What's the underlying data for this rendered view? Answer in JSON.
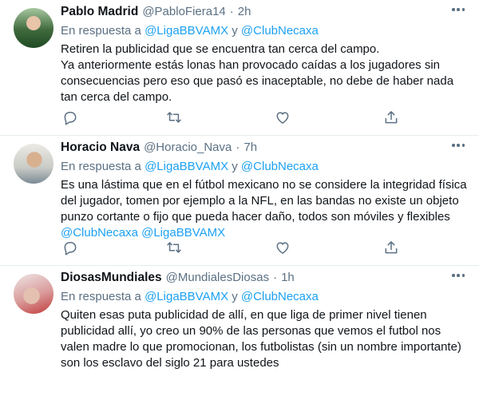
{
  "colors": {
    "link": "#1da1f2",
    "secondary": "#5b7083",
    "text": "#0f1419",
    "divider": "#e6ecf0"
  },
  "reply_prefix": "En respuesta a",
  "reply_joiner": "y",
  "tweets": [
    {
      "name": "Pablo Madrid",
      "handle": "@PabloFiera14",
      "separator": "·",
      "time": "2h",
      "mention_1": "@LigaBBVAMX",
      "mention_2": "@ClubNecaxa",
      "body": "Retiren la publicidad que se encuentra tan cerca del campo.\nYa anteriormente estás lonas han provocado caídas a los jugadores sin consecuencias pero eso que pasó es inaceptable, no debe de haber nada tan cerca del campo.",
      "body_mentions": ""
    },
    {
      "name": "Horacio Nava",
      "handle": "@Horacio_Nava",
      "separator": "·",
      "time": "7h",
      "mention_1": "@LigaBBVAMX",
      "mention_2": "@ClubNecaxa",
      "body": "Es una lástima que en el fútbol mexicano no se considere la integridad física del jugador, tomen por ejemplo a la NFL, en las bandas no existe un objeto punzo cortante o fijo que pueda hacer daño, todos son móviles y flexibles ",
      "body_mentions": "@ClubNecaxa @LigaBBVAMX"
    },
    {
      "name": "DiosasMundiales",
      "handle": "@MundialesDiosas",
      "separator": "·",
      "time": "1h",
      "mention_1": "@LigaBBVAMX",
      "mention_2": "@ClubNecaxa",
      "body": "Quiten esas puta publicidad de allí, en que liga de primer nivel tienen publicidad allí, yo creo un 90% de las personas que vemos el futbol nos valen madre lo que promocionan, los futbolistas (sin un nombre importante) son los esclavo del siglo 21 para ustedes",
      "body_mentions": ""
    }
  ],
  "icons": [
    "reply-icon",
    "retweet-icon",
    "like-icon",
    "share-icon",
    "more-icon"
  ]
}
